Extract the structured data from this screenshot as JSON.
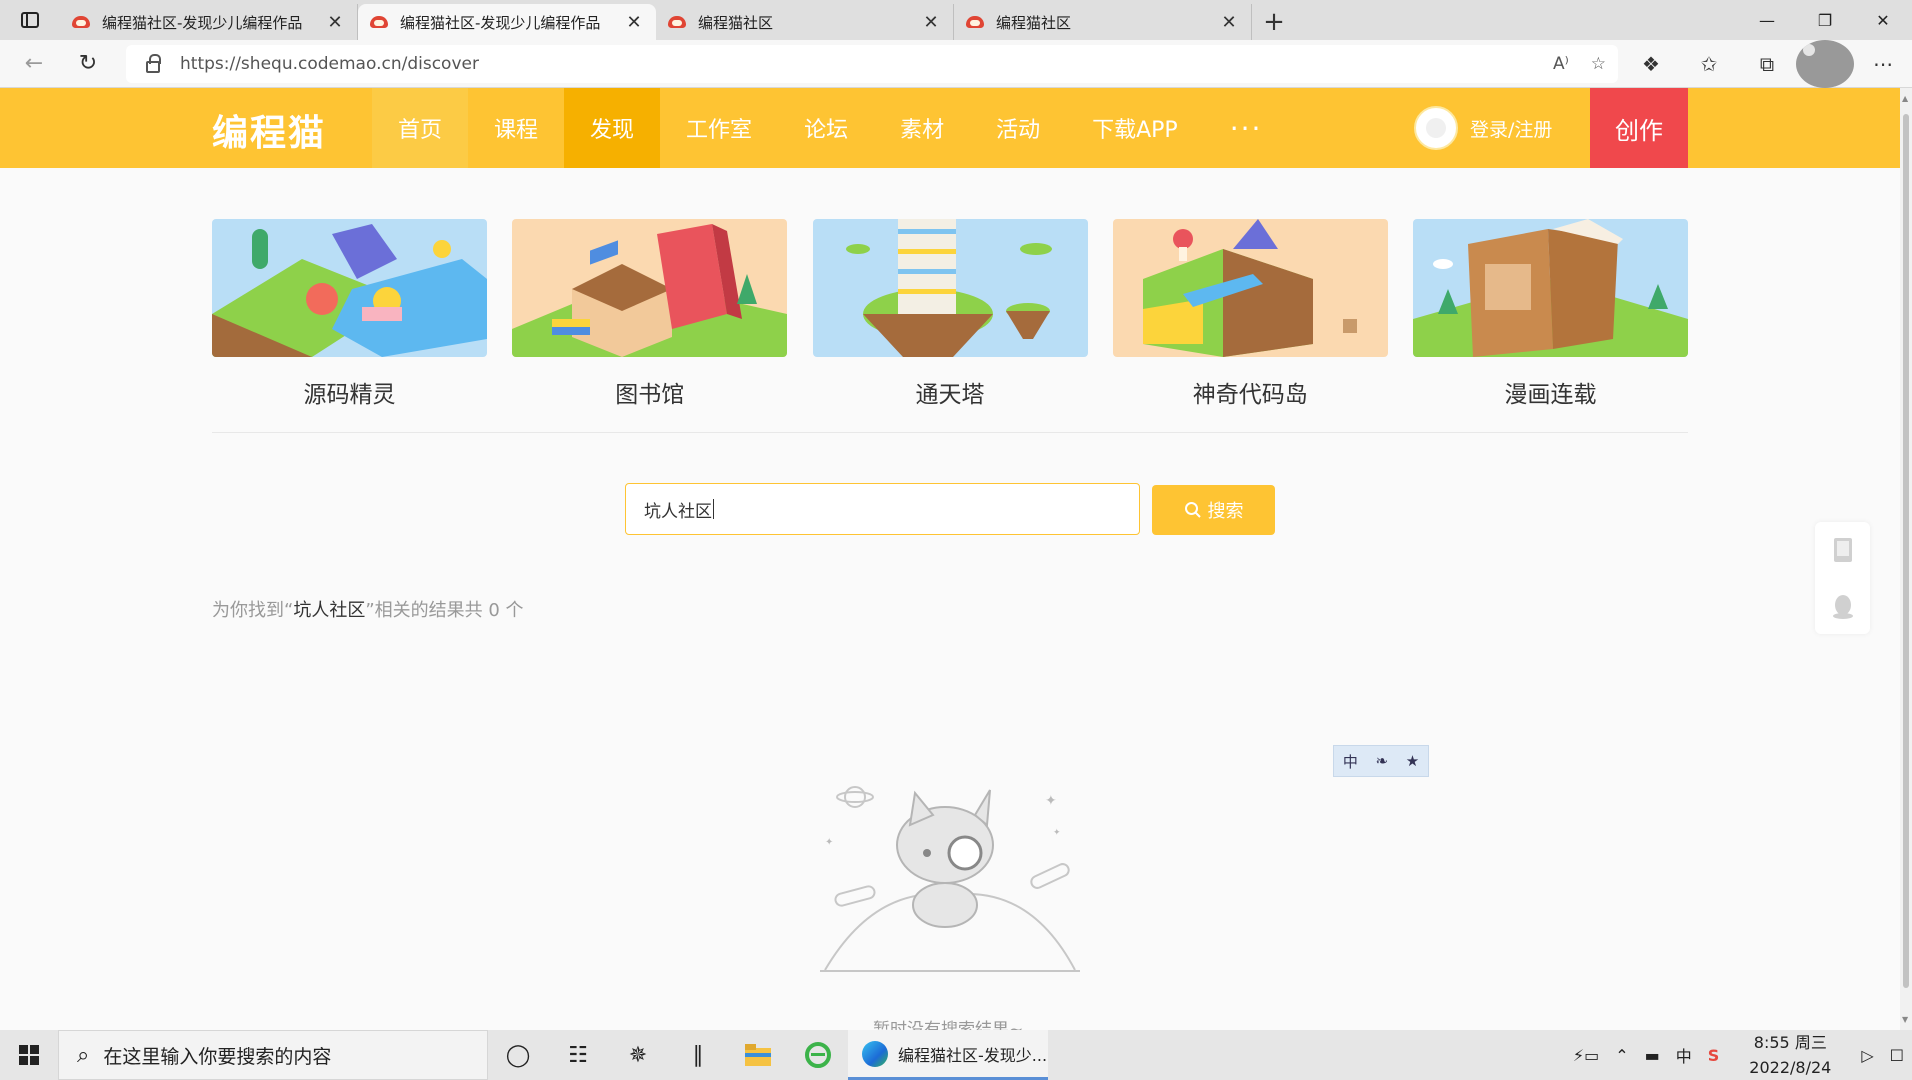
{
  "browser": {
    "tabs": [
      {
        "title": "编程猫社区-发现少儿编程作品",
        "active": false
      },
      {
        "title": "编程猫社区-发现少儿编程作品",
        "active": true
      },
      {
        "title": "编程猫社区",
        "active": false
      },
      {
        "title": "编程猫社区",
        "active": false
      }
    ],
    "close_glyph": "✕",
    "new_tab_glyph": "+",
    "url": "https://shequ.codemao.cn/discover"
  },
  "site": {
    "logo": "编程猫",
    "nav": [
      "首页",
      "课程",
      "发现",
      "工作室",
      "论坛",
      "素材",
      "活动",
      "下载APP",
      "···"
    ],
    "login_label": "登录/注册",
    "create_label": "创作",
    "accent_color": "#fec433",
    "create_color": "#f0484c"
  },
  "features": [
    {
      "label": "源码精灵"
    },
    {
      "label": "图书馆"
    },
    {
      "label": "通天塔"
    },
    {
      "label": "神奇代码岛"
    },
    {
      "label": "漫画连载"
    }
  ],
  "search": {
    "value": "坑人社区",
    "button_label": "搜索",
    "result_prefix": "为你找到“",
    "result_query": "坑人社区",
    "result_suffix": "”相关的结果共 0 个"
  },
  "empty_state": {
    "message": "暂时没有搜索结果~"
  },
  "ime": {
    "mode": "中"
  },
  "taskbar": {
    "search_placeholder": "在这里输入你要搜索的内容",
    "app_label": "编程猫社区-发现少...",
    "tray_ime": "中",
    "time": "8:55 周三",
    "date": "2022/8/24"
  }
}
